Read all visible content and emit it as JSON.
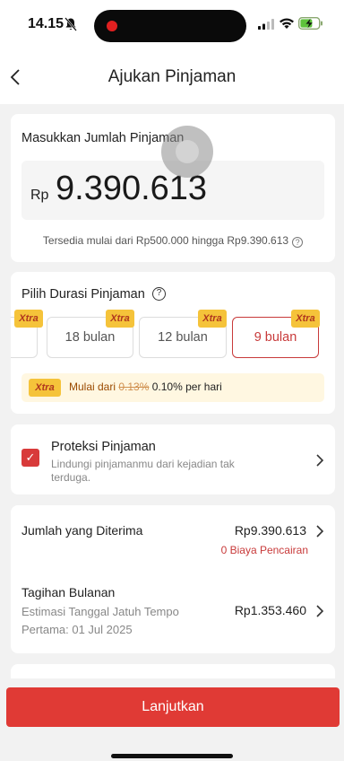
{
  "status": {
    "time": "14.15"
  },
  "header": {
    "title": "Ajukan Pinjaman"
  },
  "amount": {
    "label": "Masukkan Jumlah Pinjaman",
    "currency": "Rp",
    "value": "9.390.613",
    "range_text": "Tersedia mulai dari Rp500.000 hingga Rp9.390.613"
  },
  "duration": {
    "label": "Pilih Durasi Pinjaman",
    "badge": "Xtra",
    "options": [
      {
        "label": "18 bulan"
      },
      {
        "label": "12 bulan"
      },
      {
        "label": "9 bulan",
        "selected": true
      }
    ],
    "promo": {
      "badge": "Xtra",
      "prefix": "Mulai dari",
      "old_rate": "0.13%",
      "new_rate": "0.10% per hari"
    }
  },
  "protection": {
    "title": "Proteksi Pinjaman",
    "description": "Lindungi pinjamanmu dari kejadian tak terduga.",
    "checked": true
  },
  "summary": {
    "received_label": "Jumlah yang Diterima",
    "received_value": "Rp9.390.613",
    "fee_text": "0 Biaya Pencairan",
    "monthly_label": "Tagihan Bulanan",
    "monthly_value": "Rp1.353.460",
    "due_label": "Estimasi Tanggal Jatuh Tempo",
    "due_date": "Pertama: 01 Jul 2025"
  },
  "cta": {
    "label": "Lanjutkan"
  },
  "colors": {
    "accent": "#e03a35",
    "xtra_badge": "#f5c33a"
  }
}
